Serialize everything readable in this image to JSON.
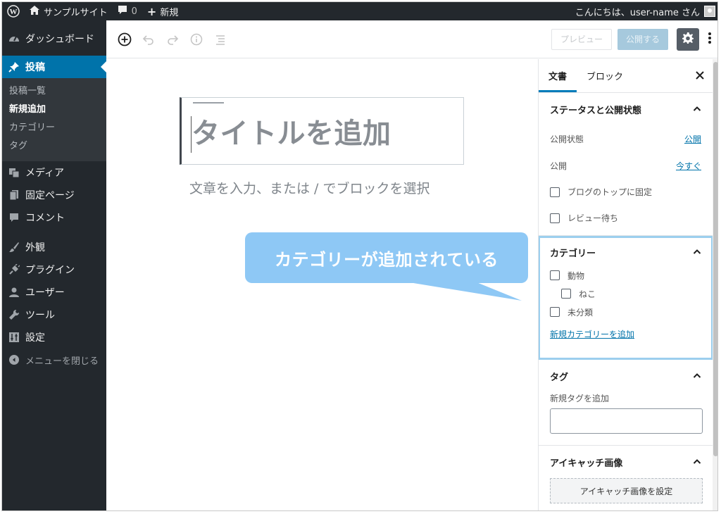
{
  "adminbar": {
    "site_name": "サンプルサイト",
    "comments_count": "0",
    "new_label": "新規",
    "greeting": "こんにちは、user-name さん"
  },
  "sidebar": {
    "items": [
      {
        "label": "ダッシュボード",
        "icon": "dashboard-icon"
      },
      {
        "label": "投稿",
        "icon": "pin-icon"
      },
      {
        "label": "メディア",
        "icon": "media-icon"
      },
      {
        "label": "固定ページ",
        "icon": "page-icon"
      },
      {
        "label": "コメント",
        "icon": "comment-icon"
      },
      {
        "label": "外観",
        "icon": "brush-icon"
      },
      {
        "label": "プラグイン",
        "icon": "plugin-icon"
      },
      {
        "label": "ユーザー",
        "icon": "user-icon"
      },
      {
        "label": "ツール",
        "icon": "wrench-icon"
      },
      {
        "label": "設定",
        "icon": "settings-icon"
      }
    ],
    "submenu": [
      "投稿一覧",
      "新規追加",
      "カテゴリー",
      "タグ"
    ],
    "collapse_label": "メニューを閉じる"
  },
  "toolbar": {
    "preview_label": "プレビュー",
    "publish_label": "公開する"
  },
  "editor": {
    "title_placeholder": "タイトルを追加",
    "body_placeholder": "文章を入力、または / でブロックを選択"
  },
  "callout": {
    "text": "カテゴリーが追加されている"
  },
  "panel": {
    "tabs": [
      "文書",
      "ブロック"
    ],
    "status": {
      "heading": "ステータスと公開状態",
      "visibility_label": "公開状態",
      "visibility_value": "公開",
      "publish_label": "公開",
      "publish_value": "今すぐ",
      "sticky_label": "ブログのトップに固定",
      "pending_label": "レビュー待ち"
    },
    "categories": {
      "heading": "カテゴリー",
      "items": [
        {
          "label": "動物",
          "child": false
        },
        {
          "label": "ねこ",
          "child": true
        },
        {
          "label": "未分類",
          "child": false
        }
      ],
      "add_link": "新規カテゴリーを追加"
    },
    "tags": {
      "heading": "タグ",
      "add_label": "新規タグを追加"
    },
    "featured": {
      "heading": "アイキャッチ画像",
      "button_label": "アイキャッチ画像を設定"
    }
  },
  "colors": {
    "admin_dark": "#23282d",
    "active_blue": "#0073aa",
    "callout_blue": "#8ec8f5",
    "highlight_border": "#9ccfee"
  }
}
